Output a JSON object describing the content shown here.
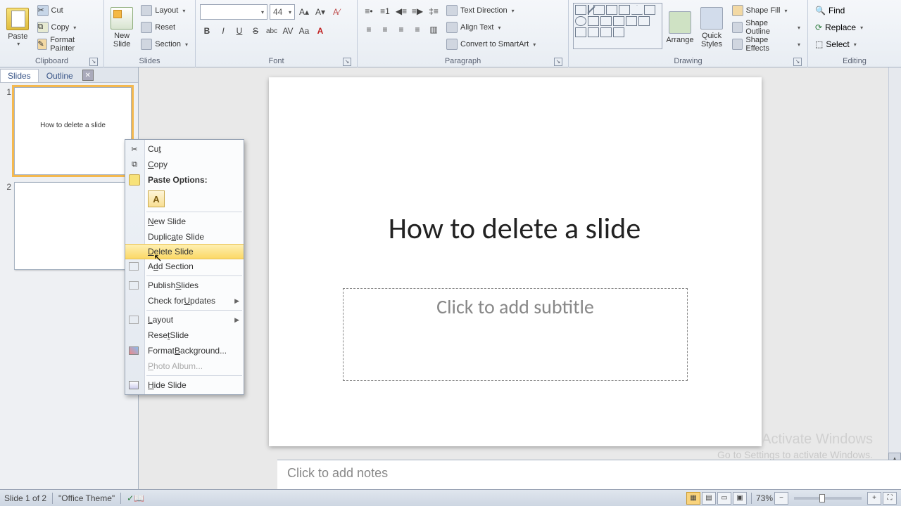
{
  "ribbon": {
    "clipboard": {
      "paste": "Paste",
      "cut": "Cut",
      "copy": "Copy",
      "format_painter": "Format Painter",
      "group": "Clipboard"
    },
    "slides": {
      "new_slide": "New\nSlide",
      "layout": "Layout",
      "reset": "Reset",
      "section": "Section",
      "group": "Slides"
    },
    "font": {
      "size": "44",
      "group": "Font"
    },
    "paragraph": {
      "text_direction": "Text Direction",
      "align_text": "Align Text",
      "convert": "Convert to SmartArt",
      "group": "Paragraph"
    },
    "drawing": {
      "arrange": "Arrange",
      "quick_styles": "Quick\nStyles",
      "shape_fill": "Shape Fill",
      "shape_outline": "Shape Outline",
      "shape_effects": "Shape Effects",
      "group": "Drawing"
    },
    "editing": {
      "find": "Find",
      "replace": "Replace",
      "select": "Select",
      "group": "Editing"
    }
  },
  "pane": {
    "tab_slides": "Slides",
    "tab_outline": "Outline",
    "thumb1_num": "1",
    "thumb1_title": "How to delete a slide",
    "thumb2_num": "2"
  },
  "context_menu": {
    "cut": "Cut",
    "copy": "Copy",
    "paste_options": "Paste Options:",
    "new_slide": "New Slide",
    "duplicate": "Duplicate Slide",
    "delete": "Delete Slide",
    "add_section": "Add Section",
    "publish": "Publish Slides",
    "check_updates": "Check for Updates",
    "layout": "Layout",
    "reset": "Reset Slide",
    "format_bg": "Format Background...",
    "photo_album": "Photo Album...",
    "hide": "Hide Slide"
  },
  "canvas": {
    "title": "How to delete a slide",
    "subtitle_placeholder": "Click to add subtitle"
  },
  "notes": {
    "placeholder": "Click to add notes"
  },
  "watermark": {
    "line1": "Activate Windows",
    "line2": "Go to Settings to activate Windows."
  },
  "status": {
    "slide_info": "Slide 1 of 2",
    "theme": "\"Office Theme\"",
    "zoom": "73%"
  }
}
